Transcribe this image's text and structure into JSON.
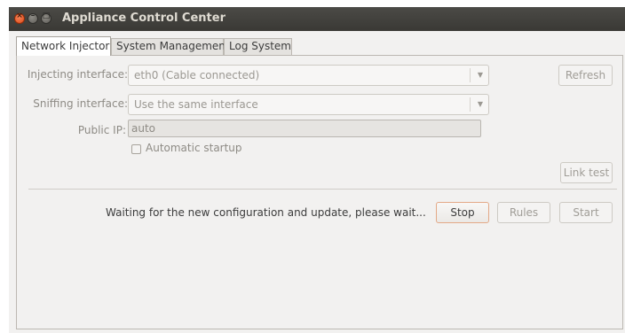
{
  "window": {
    "title": "Appliance Control Center"
  },
  "tabs": [
    {
      "label": "Network Injector",
      "active": true
    },
    {
      "label": "System Management",
      "active": false
    },
    {
      "label": "Log System",
      "active": false
    }
  ],
  "form": {
    "injecting_label": "Injecting interface:",
    "injecting_value": "eth0 (Cable connected)",
    "sniffing_label": "Sniffing interface:",
    "sniffing_value": "Use the same interface",
    "public_ip_label": "Public IP:",
    "public_ip_value": "auto",
    "autostart_label": "Automatic startup",
    "autostart_checked": false
  },
  "buttons": {
    "refresh": "Refresh",
    "link_test": "Link test",
    "stop": "Stop",
    "rules": "Rules",
    "start": "Start"
  },
  "status": {
    "message": "Waiting for the new configuration and update, please wait..."
  },
  "icons": {
    "close": "close-icon",
    "minimize": "minimize-icon",
    "maximize": "maximize-icon",
    "dropdown": "chevron-down-icon"
  },
  "colors": {
    "titlebar": "#3c3b37",
    "close": "#df4a16",
    "focus_border": "#e3a987"
  }
}
